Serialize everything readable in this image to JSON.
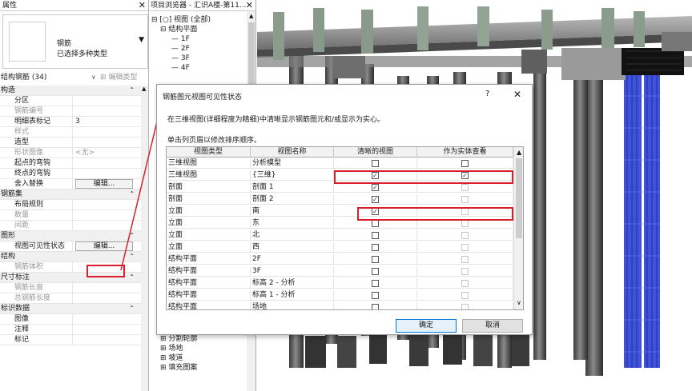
{
  "properties": {
    "title": "属性",
    "type_name": "钢筋",
    "type_sub": "已选择多种类型",
    "filter_label": "结构钢筋 (34)",
    "edit_type": "编辑类型",
    "rows": [
      {
        "kind": "sec",
        "label": "构造"
      },
      {
        "kind": "row",
        "label": "分区",
        "value": ""
      },
      {
        "kind": "grey",
        "label": "钢筋编号",
        "value": ""
      },
      {
        "kind": "row",
        "label": "明细表标记",
        "value": "3"
      },
      {
        "kind": "grey",
        "label": "样式",
        "value": ""
      },
      {
        "kind": "row",
        "label": "造型",
        "value": ""
      },
      {
        "kind": "grey",
        "label": "形状图像",
        "value": "<无>"
      },
      {
        "kind": "row",
        "label": "起点的弯钩",
        "value": ""
      },
      {
        "kind": "row",
        "label": "终点的弯钩",
        "value": ""
      },
      {
        "kind": "btn",
        "label": "舍入替换",
        "value": "编辑..."
      },
      {
        "kind": "sec",
        "label": "钢筋集"
      },
      {
        "kind": "row",
        "label": "布局规则",
        "value": ""
      },
      {
        "kind": "grey",
        "label": "数量",
        "value": ""
      },
      {
        "kind": "grey",
        "label": "间距",
        "value": ""
      },
      {
        "kind": "sec",
        "label": "图形"
      },
      {
        "kind": "btn",
        "label": "视图可见性状态",
        "value": "编辑..."
      },
      {
        "kind": "sec",
        "label": "结构"
      },
      {
        "kind": "grey",
        "label": "钢筋体积",
        "value": ""
      },
      {
        "kind": "sec",
        "label": "尺寸标注"
      },
      {
        "kind": "grey",
        "label": "钢筋长度",
        "value": ""
      },
      {
        "kind": "grey",
        "label": "总钢筋长度",
        "value": ""
      },
      {
        "kind": "sec",
        "label": "标识数据"
      },
      {
        "kind": "row",
        "label": "图像",
        "value": ""
      },
      {
        "kind": "row",
        "label": "注释",
        "value": ""
      },
      {
        "kind": "row",
        "label": "标记",
        "value": ""
      }
    ]
  },
  "browser": {
    "title": "项目浏览器 - 汇识A楼-第11...",
    "top_items": [
      "视图 (全部)",
      "结构平面",
      "1F",
      "2F",
      "3F",
      "4F"
    ],
    "bottom_items": [
      "分割轮廓",
      "场地",
      "坡道",
      "填充图案"
    ]
  },
  "dialog": {
    "title": "钢筋图元视图可见性状态",
    "help": "?",
    "close": "✕",
    "instruction": "在三维视图(详细程度为精细)中清晰显示钢筋图元和/或显示为实心。",
    "sort_hint": "单击列页眉以修改排序顺序。",
    "columns": [
      "视图类型",
      "视图名称",
      "清晰的视图",
      "作为实体查看"
    ],
    "rows": [
      {
        "type": "三维视图",
        "name": "分析模型",
        "clear": false,
        "solid": false,
        "solid_enabled": true
      },
      {
        "type": "三维视图",
        "name": "{三维}",
        "clear": true,
        "solid": true,
        "solid_enabled": true
      },
      {
        "type": "剖面",
        "name": "剖面 1",
        "clear": true,
        "solid": false,
        "solid_enabled": false
      },
      {
        "type": "剖面",
        "name": "剖面 2",
        "clear": true,
        "solid": false,
        "solid_enabled": false
      },
      {
        "type": "立面",
        "name": "南",
        "clear": true,
        "solid": false,
        "solid_enabled": false
      },
      {
        "type": "立面",
        "name": "东",
        "clear": false,
        "solid": false,
        "solid_enabled": false
      },
      {
        "type": "立面",
        "name": "北",
        "clear": false,
        "solid": false,
        "solid_enabled": false
      },
      {
        "type": "立面",
        "name": "西",
        "clear": false,
        "solid": false,
        "solid_enabled": false
      },
      {
        "type": "结构平面",
        "name": "2F",
        "clear": false,
        "solid": false,
        "solid_enabled": false
      },
      {
        "type": "结构平面",
        "name": "3F",
        "clear": false,
        "solid": false,
        "solid_enabled": false
      },
      {
        "type": "结构平面",
        "name": "标高 2 - 分析",
        "clear": false,
        "solid": false,
        "solid_enabled": false
      },
      {
        "type": "结构平面",
        "name": "标高 1 - 分析",
        "clear": false,
        "solid": false,
        "solid_enabled": false
      },
      {
        "type": "结构平面",
        "name": "场地",
        "clear": false,
        "solid": false,
        "solid_enabled": false
      }
    ],
    "ok": "确定",
    "cancel": "取消"
  },
  "colors": {
    "highlight": "#d9202a",
    "rebar_blue": "#2a3fd6"
  }
}
